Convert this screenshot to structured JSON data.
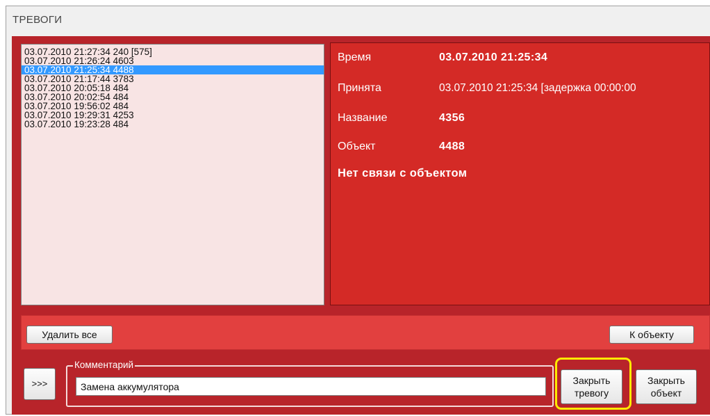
{
  "window": {
    "title": "ТРЕВОГИ"
  },
  "alarm_list": {
    "items": [
      {
        "label": "03.07.2010 21:27:34  240 [575]",
        "selected": false
      },
      {
        "label": "03.07.2010 21:26:24  4603",
        "selected": false
      },
      {
        "label": "03.07.2010 21:25:34  4488",
        "selected": true
      },
      {
        "label": "03.07.2010 21:17:44  3783",
        "selected": false
      },
      {
        "label": "03.07.2010 20:05:18  484",
        "selected": false
      },
      {
        "label": "03.07.2010 20:02:54  484",
        "selected": false
      },
      {
        "label": "03.07.2010 19:56:02  484",
        "selected": false
      },
      {
        "label": "03.07.2010 19:29:31  4253",
        "selected": false
      },
      {
        "label": "03.07.2010 19:23:28  484",
        "selected": false
      }
    ]
  },
  "details": {
    "time_label": "Время",
    "time_value": "03.07.2010 21:25:34",
    "accepted_label": "Принята",
    "accepted_value": "03.07.2010 21:25:34 [задержка 00:00:00",
    "name_label": "Название",
    "name_value": "4356",
    "object_label": "Объект",
    "object_value": "4488",
    "status_text": "Нет связи с объектом"
  },
  "actions": {
    "delete_all_label": "Удалить все",
    "goto_object_label": "К объекту"
  },
  "comment": {
    "expand_label": ">>>",
    "legend": "Комментарий",
    "value": "Замена аккумулятора"
  },
  "buttons": {
    "close_alarm_line1": "Закрыть",
    "close_alarm_line2": "тревогу",
    "close_object_line1": "Закрыть",
    "close_object_line2": "объект"
  },
  "colors": {
    "frame": "#b8242a",
    "detail_bg": "#d42a26",
    "action_bar": "#e2403f",
    "list_bg": "#f8e4e4",
    "selection": "#3399ff",
    "highlight": "#ffea00"
  }
}
